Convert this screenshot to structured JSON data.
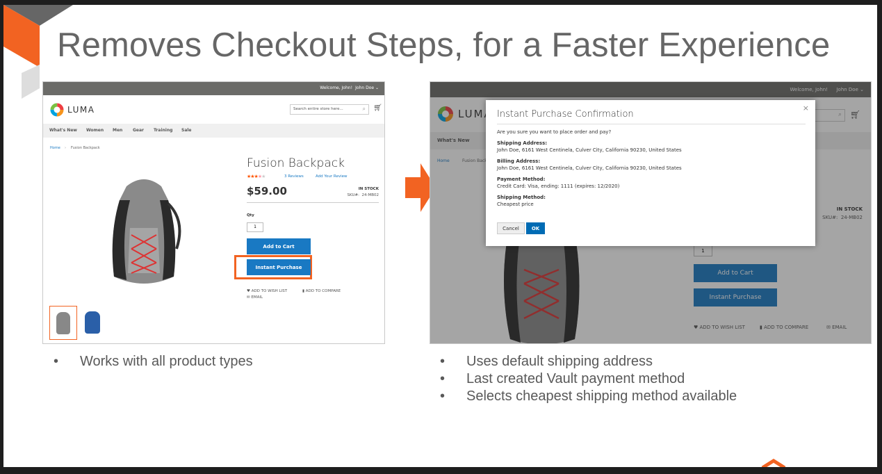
{
  "slide": {
    "title": "Removes Checkout Steps, for a Faster Experience",
    "accent_color": "#f26322",
    "left_bullets": [
      "Works with all product types"
    ],
    "right_bullets": [
      "Uses default shipping address",
      "Last created Vault payment method",
      "Selects cheapest shipping method available"
    ]
  },
  "store": {
    "welcome": "Welcome, John!",
    "account": "John Doe",
    "logo": "LUMA",
    "search_placeholder": "Search entire store here...",
    "nav": [
      "What's New",
      "Women",
      "Men",
      "Gear",
      "Training",
      "Sale"
    ],
    "breadcrumb": [
      "Home",
      "Fusion Backpack"
    ],
    "product": {
      "name": "Fusion Backpack",
      "rating": 3.5,
      "rating_max": 5,
      "reviews": "3  Reviews",
      "add_review": "Add Your Review",
      "price": "$59.00",
      "stock": "IN STOCK",
      "sku_label": "SKU#:",
      "sku": "24-MB02",
      "qty_label": "Qty",
      "qty": "1",
      "add_to_cart": "Add to Cart",
      "instant_purchase": "Instant Purchase",
      "wishlist": "ADD TO WISH LIST",
      "compare": "ADD TO COMPARE",
      "email": "EMAIL"
    },
    "brand_color": "#1979c3"
  },
  "modal": {
    "title": "Instant Purchase Confirmation",
    "question": "Are you sure you want to place order and pay?",
    "sections": [
      {
        "label": "Shipping Address:",
        "value": "John Doe, 6161 West Centinela, Culver City, California 90230, United States"
      },
      {
        "label": "Billing Address:",
        "value": "John Doe, 6161 West Centinela, Culver City, California 90230, United States"
      },
      {
        "label": "Payment Method:",
        "value": "Credit Card: Visa, ending: 1111 (expires: 12/2020)"
      },
      {
        "label": "Shipping Method:",
        "value": "Cheapest price"
      }
    ],
    "cancel": "Cancel",
    "ok": "OK"
  }
}
